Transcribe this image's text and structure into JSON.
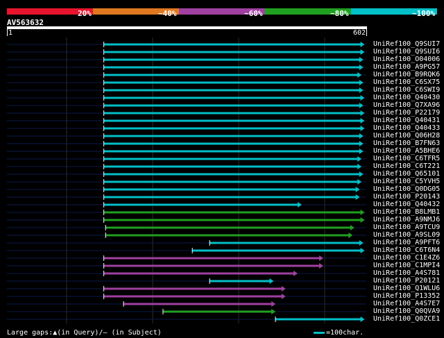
{
  "legend": {
    "segments": [
      {
        "color": "#e8142e",
        "label": "20%"
      },
      {
        "color": "#e07820",
        "label": "~40%"
      },
      {
        "color": "#a040a0",
        "label": "~60%"
      },
      {
        "color": "#20a020",
        "label": "~80%"
      },
      {
        "color": "#00c0c8",
        "label": "~100%"
      }
    ]
  },
  "query": {
    "name": "AV563632",
    "start": "1",
    "end": "602",
    "length": 602
  },
  "colors": {
    "track": "#0c1a4a",
    "gridline": "#2c2c2c"
  },
  "hits": [
    {
      "name": "UniRef100_Q9SUI7",
      "color": "cyan",
      "from": 163,
      "to": 598
    },
    {
      "name": "UniRef100_Q9SUI6",
      "color": "cyan",
      "from": 163,
      "to": 598
    },
    {
      "name": "UniRef100_O04006",
      "color": "cyan",
      "from": 163,
      "to": 596
    },
    {
      "name": "UniRef100_A9PG57",
      "color": "cyan",
      "from": 163,
      "to": 596
    },
    {
      "name": "UniRef100_B9RQK6",
      "color": "cyan",
      "from": 163,
      "to": 593
    },
    {
      "name": "UniRef100_C6SX75",
      "color": "cyan",
      "from": 163,
      "to": 596
    },
    {
      "name": "UniRef100_C6SWI9",
      "color": "cyan",
      "from": 163,
      "to": 596
    },
    {
      "name": "UniRef100_Q40430",
      "color": "cyan",
      "from": 163,
      "to": 598
    },
    {
      "name": "UniRef100_Q7XA96",
      "color": "cyan",
      "from": 163,
      "to": 596
    },
    {
      "name": "UniRef100_P22179",
      "color": "cyan",
      "from": 163,
      "to": 598
    },
    {
      "name": "UniRef100_Q40431",
      "color": "cyan",
      "from": 163,
      "to": 598
    },
    {
      "name": "UniRef100_Q40433",
      "color": "cyan",
      "from": 163,
      "to": 598
    },
    {
      "name": "UniRef100_Q06H28",
      "color": "cyan",
      "from": 163,
      "to": 596
    },
    {
      "name": "UniRef100_B7FN63",
      "color": "cyan",
      "from": 163,
      "to": 596
    },
    {
      "name": "UniRef100_A5BHE6",
      "color": "cyan",
      "from": 163,
      "to": 596
    },
    {
      "name": "UniRef100_C6TFR5",
      "color": "cyan",
      "from": 163,
      "to": 593
    },
    {
      "name": "UniRef100_C6T221",
      "color": "cyan",
      "from": 163,
      "to": 593
    },
    {
      "name": "UniRef100_Q65101",
      "color": "cyan",
      "from": 163,
      "to": 596
    },
    {
      "name": "UniRef100_C5YVH5",
      "color": "cyan",
      "from": 163,
      "to": 593
    },
    {
      "name": "UniRef100_Q0DG05",
      "color": "cyan",
      "from": 163,
      "to": 590
    },
    {
      "name": "UniRef100_P20143",
      "color": "cyan",
      "from": 163,
      "to": 590
    },
    {
      "name": "UniRef100_Q40432",
      "color": "cyan",
      "from": 163,
      "to": 493
    },
    {
      "name": "UniRef100_B8LMB1",
      "color": "green",
      "from": 163,
      "to": 598
    },
    {
      "name": "UniRef100_A9NMJ6",
      "color": "green",
      "from": 163,
      "to": 598
    },
    {
      "name": "UniRef100_A9TCU9",
      "color": "green",
      "from": 166,
      "to": 581
    },
    {
      "name": "UniRef100_A9SL09",
      "color": "green",
      "from": 166,
      "to": 578
    },
    {
      "name": "UniRef100_A9PFT6",
      "color": "cyan",
      "from": 340,
      "to": 596
    },
    {
      "name": "UniRef100_C6T6N4",
      "color": "cyan",
      "from": 311,
      "to": 598
    },
    {
      "name": "UniRef100_C1E4Z6",
      "color": "purple",
      "from": 163,
      "to": 529
    },
    {
      "name": "UniRef100_C1MPI4",
      "color": "purple",
      "from": 163,
      "to": 529
    },
    {
      "name": "UniRef100_A4S781",
      "color": "purple",
      "from": 163,
      "to": 486
    },
    {
      "name": "UniRef100_P20121",
      "color": "cyan",
      "from": 340,
      "to": 446
    },
    {
      "name": "UniRef100_Q1WLU6",
      "color": "purple",
      "from": 163,
      "to": 466
    },
    {
      "name": "UniRef100_P13352",
      "color": "purple",
      "from": 163,
      "to": 466
    },
    {
      "name": "UniRef100_A4S7E7",
      "color": "purple",
      "from": 196,
      "to": 449
    },
    {
      "name": "UniRef100_Q0QVA9",
      "color": "green",
      "from": 262,
      "to": 449
    },
    {
      "name": "UniRef100_Q0ZCE1",
      "color": "cyan",
      "from": 450,
      "to": 598
    }
  ],
  "footer": {
    "gaps_text": "Large gaps:▲(in Query)/– (in Subject)",
    "scale_text": "=100char."
  }
}
